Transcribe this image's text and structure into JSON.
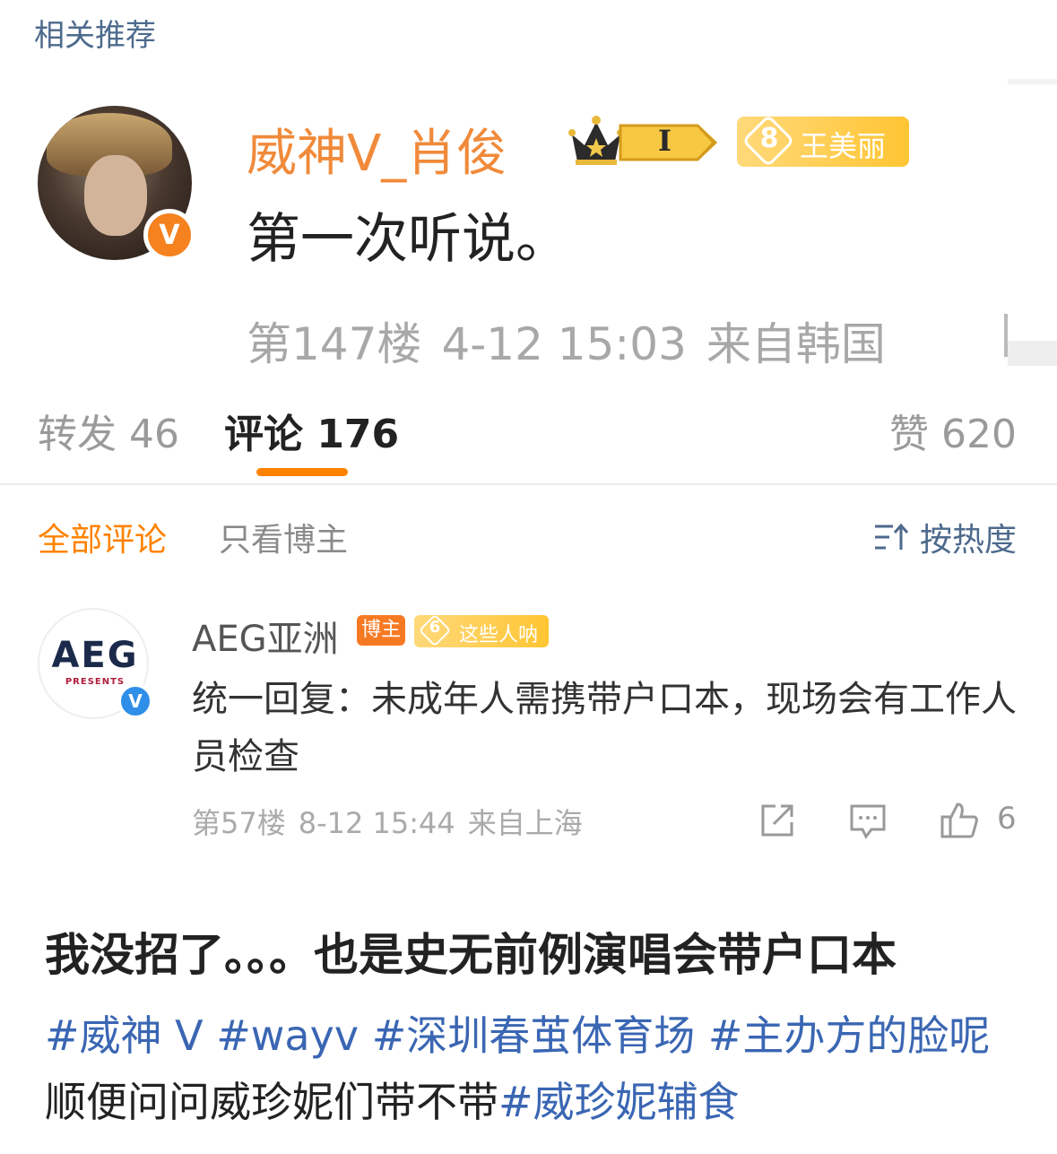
{
  "header": {
    "related": "相关推荐"
  },
  "post": {
    "username": "威神V_肖俊",
    "level_badge": "I",
    "fan_badge": {
      "level": "8",
      "name": "王美丽"
    },
    "content": "第一次听说。",
    "floor": "第147楼",
    "time": "4-12 15:03",
    "location": "来自韩国"
  },
  "tabs": {
    "repost": "转发 46",
    "comments": "评论 176",
    "likes": "赞 620"
  },
  "filters": {
    "all": "全部评论",
    "host_only": "只看博主",
    "sort": "按热度"
  },
  "comment": {
    "avatar_logo": "AEG",
    "avatar_sub": "PRESENTS",
    "username": "AEG亚洲",
    "host_badge": "博主",
    "fan_badge": {
      "level": "6",
      "name": "这些人呐"
    },
    "text": "统一回复：未成年人需携带户口本，现场会有工作人员检查",
    "floor": "第57楼",
    "time": "8-12 15:44",
    "location": "来自上海",
    "like_count": "6"
  },
  "caption": {
    "title": "我没招了。。。也是史无前例演唱会带户口本",
    "tags": [
      "#威神 V",
      "#wayv",
      "#深圳春茧体育场",
      "#主办方的脸呢"
    ],
    "plain": "顺便问问威珍妮们带不带",
    "last_tag": "#威珍妮辅食"
  },
  "colors": {
    "accent": "#ff8200",
    "username": "#f08a3a",
    "link": "#3a66b3",
    "muted": "#a8a8a8"
  }
}
